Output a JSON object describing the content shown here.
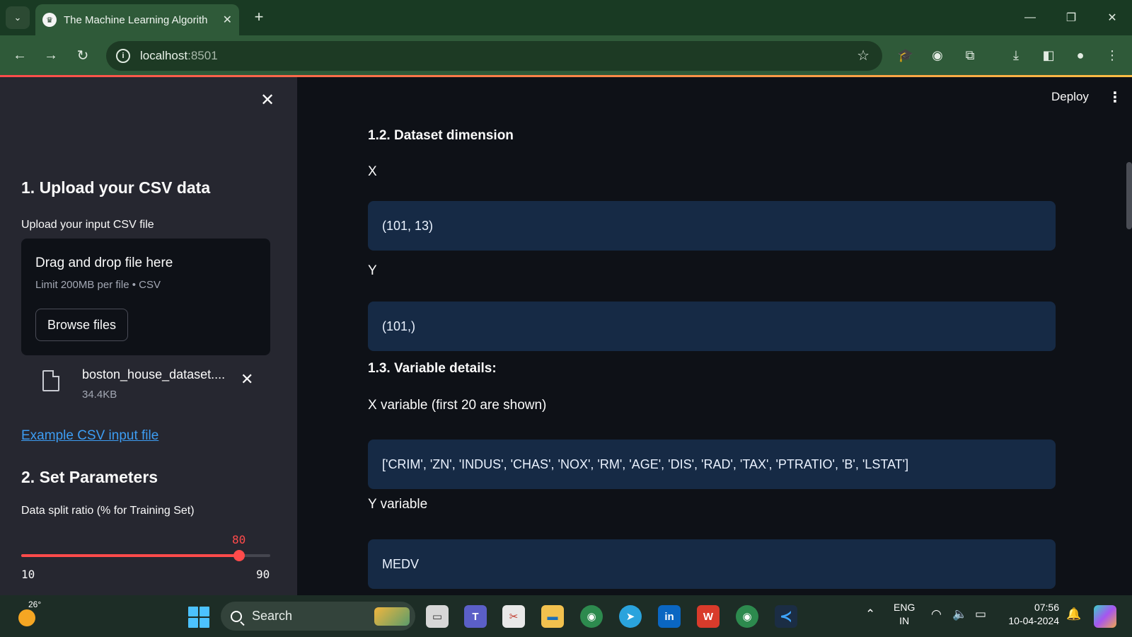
{
  "browser": {
    "tab_title": "The Machine Learning Algorith",
    "tab_favicon": "streamlit-crown-icon",
    "new_tab": "+",
    "url_host": "localhost",
    "url_port": ":8501",
    "window_controls": [
      "—",
      "❐",
      "✕"
    ]
  },
  "sidebar": {
    "close": "✕",
    "section1_title": "1. Upload your CSV data",
    "upload_label": "Upload your input CSV file",
    "dropzone_title": "Drag and drop file here",
    "dropzone_limit": "Limit 200MB per file • CSV",
    "browse_button": "Browse files",
    "file_name": "boston_house_dataset....",
    "file_size": "34.4KB",
    "file_remove": "✕",
    "example_link": "Example CSV input file",
    "section2_title": "2. Set Parameters",
    "slider": {
      "label": "Data split ratio (% for Training Set)",
      "value": "80",
      "min": "10",
      "max": "90",
      "fraction": 0.875
    }
  },
  "main": {
    "deploy": "Deploy",
    "menu": "⋮",
    "dimension_heading": "1.2. Dataset dimension",
    "x_label": "X",
    "x_shape": "(101, 13)",
    "y_label": "Y",
    "y_shape": "(101,)",
    "variable_heading": "1.3. Variable details:",
    "x_variable_label": "X variable (first 20 are shown)",
    "x_variables": "['CRIM', 'ZN', 'INDUS', 'CHAS', 'NOX', 'RM', 'AGE', 'DIS', 'RAD', 'TAX', 'PTRATIO', 'B', 'LSTAT']",
    "y_variable_label": "Y variable",
    "y_variable": "MEDV"
  },
  "taskbar": {
    "weather_temp": "26°",
    "search_placeholder": "Search",
    "lang_line1": "ENG",
    "lang_line2": "IN",
    "time": "07:56",
    "date": "10-04-2024"
  },
  "colors": {
    "accent": "#ff4b4b",
    "link": "#3d9df3",
    "code_bg": "#162a45",
    "sidebar_bg": "#262730",
    "main_bg": "#0e1117"
  }
}
